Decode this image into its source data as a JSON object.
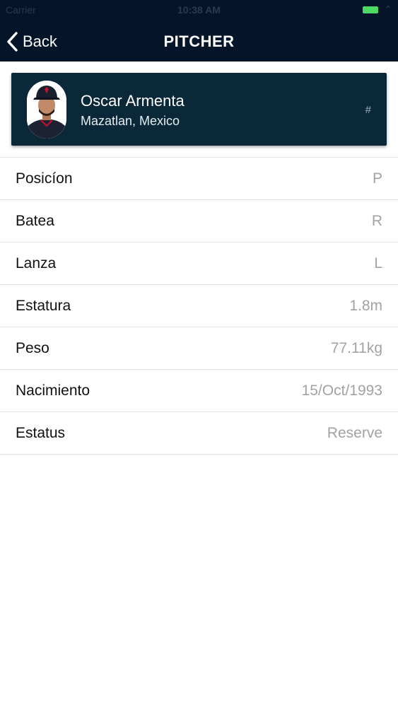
{
  "status_bar": {
    "carrier": "Carrier",
    "time": "10:38 AM"
  },
  "nav": {
    "back_label": "Back",
    "title": "PITCHER"
  },
  "player": {
    "name": "Oscar Armenta",
    "origin": "Mazatlan, Mexico",
    "number": "#"
  },
  "details": [
    {
      "label": "Posicíon",
      "value": "P"
    },
    {
      "label": "Batea",
      "value": "R"
    },
    {
      "label": "Lanza",
      "value": "L"
    },
    {
      "label": "Estatura",
      "value": "1.8m"
    },
    {
      "label": "Peso",
      "value": "77.11kg"
    },
    {
      "label": "Nacimiento",
      "value": "15/Oct/1993"
    },
    {
      "label": "Estatus",
      "value": "Reserve"
    }
  ],
  "colors": {
    "nav_background": "#04152a",
    "card_background": "#0a2838",
    "value_text": "#a2a2a2",
    "battery": "#4cd964"
  }
}
